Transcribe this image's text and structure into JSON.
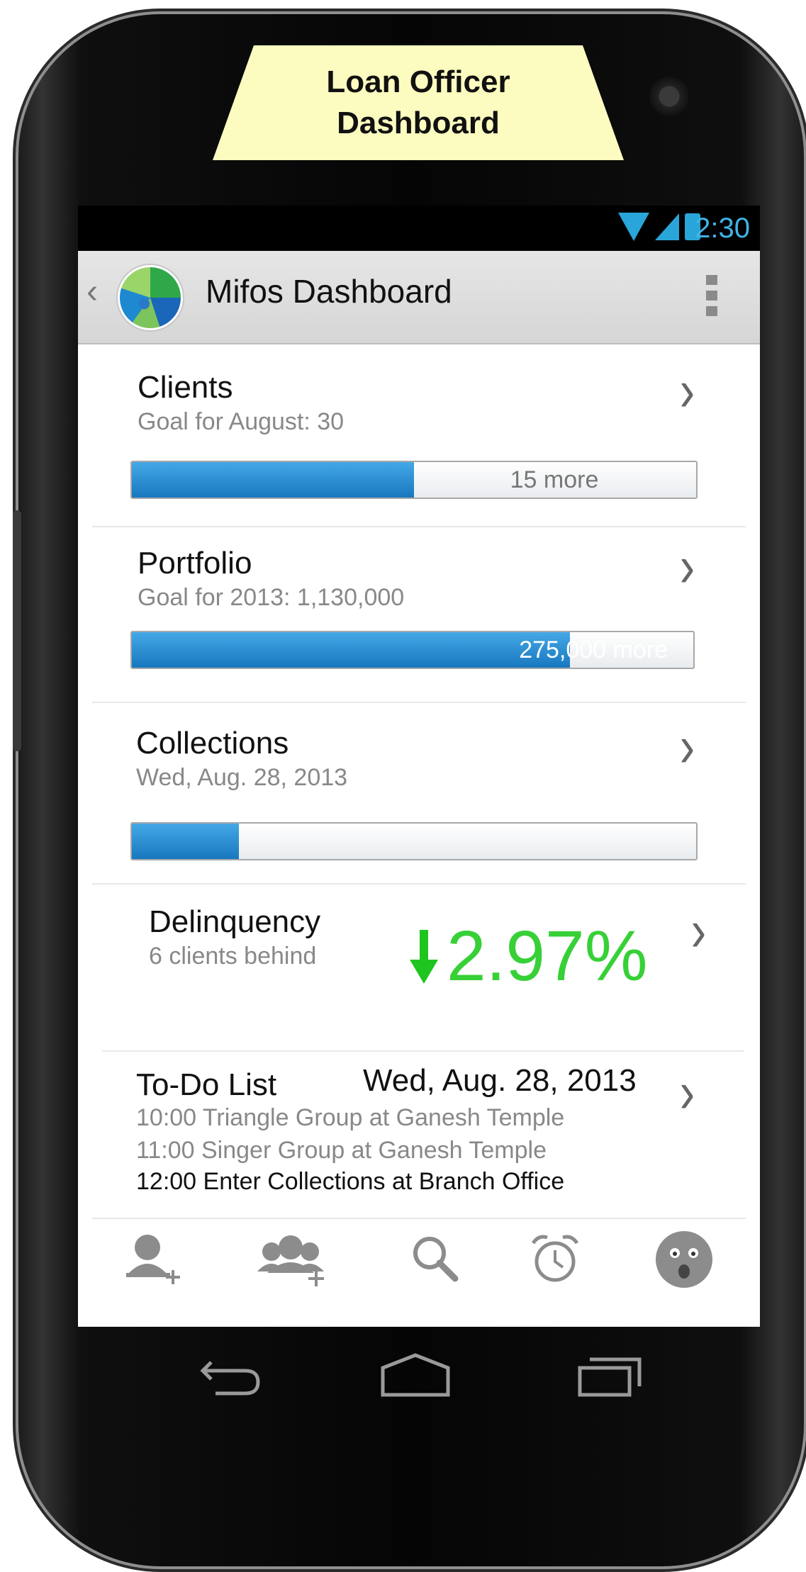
{
  "callout": {
    "line1": "Loan Officer",
    "line2": "Dashboard"
  },
  "statusbar": {
    "time": "2:30",
    "icons": [
      "wifi-icon",
      "signal-icon",
      "battery-icon"
    ],
    "accent_color": "#2aa5d9"
  },
  "actionbar": {
    "title": "Mifos Dashboard"
  },
  "clients": {
    "title": "Clients",
    "subtitle": "Goal for August:  30",
    "progress": 0.5,
    "bar_label": "15 more"
  },
  "portfolio": {
    "title": "Portfolio",
    "subtitle": "Goal for 2013:  1,130,000",
    "progress": 0.78,
    "bar_label": "275,000 more"
  },
  "collections": {
    "title": "Collections",
    "subtitle": "Wed, Aug. 28, 2013",
    "progress": 0.19
  },
  "delinquency": {
    "title": "Delinquency",
    "subtitle": "6 clients behind",
    "value": "2.97%",
    "trend": "down",
    "value_color": "#37d037"
  },
  "todo": {
    "title": "To-Do List",
    "date": "Wed, Aug. 28, 2013",
    "items": [
      "10:00 Triangle Group at Ganesh Temple",
      "11:00 Singer Group at Ganesh Temple",
      "12:00 Enter Collections at Branch Office"
    ]
  },
  "bottom_nav": [
    "add-client-icon",
    "add-group-icon",
    "search-icon",
    "alarm-icon",
    "sad-face-icon"
  ],
  "system_nav": [
    "back-icon",
    "home-icon",
    "recents-icon"
  ]
}
